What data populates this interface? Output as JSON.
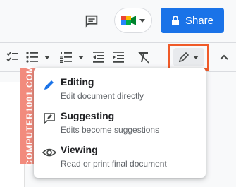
{
  "header": {
    "share_label": "Share"
  },
  "mode_menu": {
    "items": [
      {
        "title": "Editing",
        "subtitle": "Edit document directly"
      },
      {
        "title": "Suggesting",
        "subtitle": "Edits become suggestions"
      },
      {
        "title": "Viewing",
        "subtitle": "Read or print final document"
      }
    ]
  },
  "watermark": {
    "text": "COMPUTER1001.COM"
  },
  "colors": {
    "accent": "#1a73e8",
    "highlight": "#f05a28",
    "watermark": "#f28b7d",
    "editing_icon": "#1a73e8"
  }
}
